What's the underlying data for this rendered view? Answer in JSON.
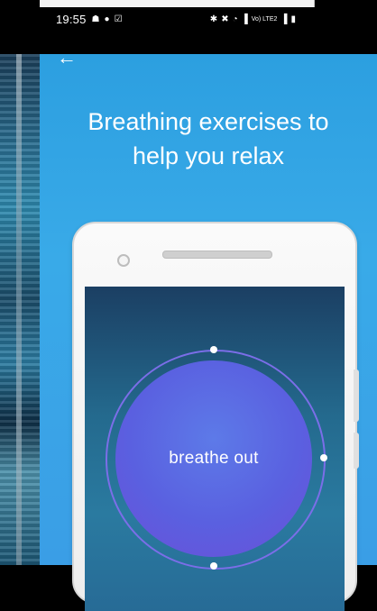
{
  "status_bar": {
    "time": "19:55",
    "left_icons": [
      "notification-icon",
      "spotify-icon",
      "checkbox-icon"
    ],
    "right_icons": [
      "bluetooth-icon",
      "mute-icon",
      "wifi-icon",
      "signal-icon",
      "lte-icon",
      "signal-icon",
      "battery-icon"
    ],
    "lte_label": "Vo) LTE2"
  },
  "nav": {
    "back_icon": "arrow-left-icon"
  },
  "headline": {
    "line1": "Breathing exercises to",
    "line2": "help you relax"
  },
  "breathing": {
    "label": "breathe out"
  },
  "colors": {
    "accent_blue": "#39aae8",
    "ring": "#7b6ee8",
    "circle": "#5a60e0"
  }
}
